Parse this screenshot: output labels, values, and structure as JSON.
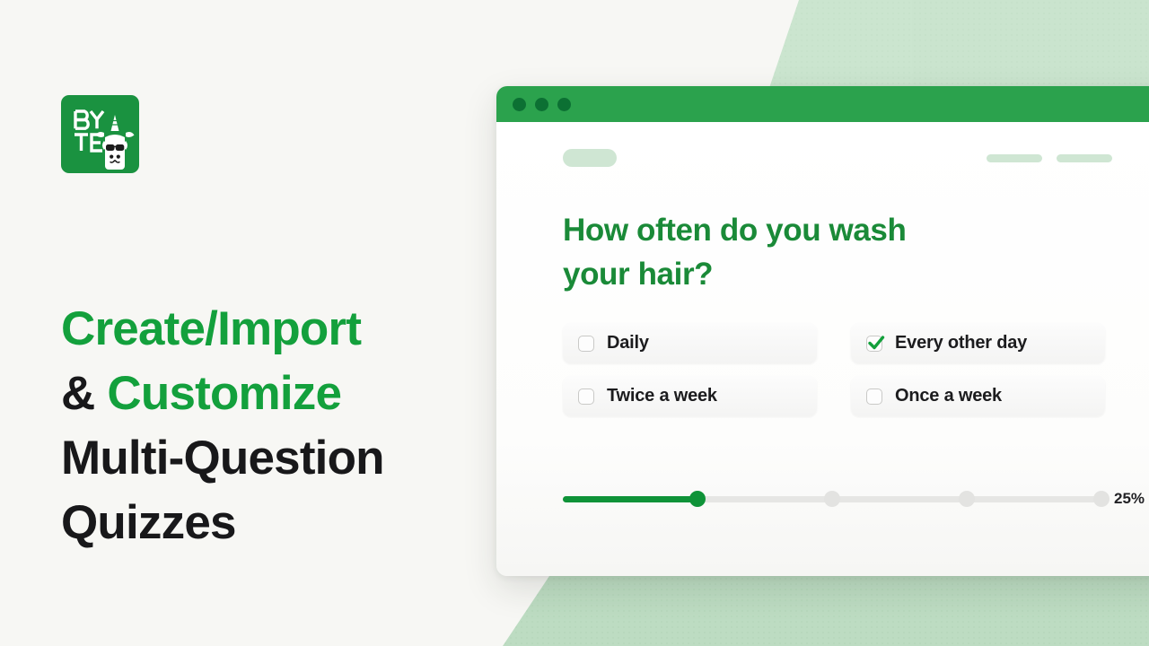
{
  "theme": {
    "background": "#f7f7f4",
    "brand_green": "#13a03c",
    "titlebar_green": "#2ba24d",
    "dot_green": "#0c7033",
    "question_green": "#1a8a38",
    "headline_dark": "#18181a"
  },
  "brand": {
    "logo_name": "byte-logo",
    "logo_text_line1": "BY",
    "logo_text_line2": "TE",
    "mascot": "llama-with-sunglasses-icon"
  },
  "headline": {
    "line1_accent": "Create/Import",
    "line2_plain": "& ",
    "line2_accent": "Customize",
    "line3_plain": "Multi-Question",
    "line4_plain": "Quizzes"
  },
  "window": {
    "traffic_lights": [
      "close-dot",
      "minimize-dot",
      "maximize-dot"
    ],
    "placeholder_chip": "",
    "placeholder_chips_right": [
      "",
      ""
    ],
    "question": "How often do you wash your hair?",
    "options": [
      {
        "label": "Daily",
        "checked": false
      },
      {
        "label": "Every other day",
        "checked": true
      },
      {
        "label": "Twice a week",
        "checked": false
      },
      {
        "label": "Once a week",
        "checked": false
      }
    ],
    "progress": {
      "percent_label": "25%",
      "value": 25,
      "nodes": [
        25,
        50,
        75,
        100
      ]
    }
  }
}
